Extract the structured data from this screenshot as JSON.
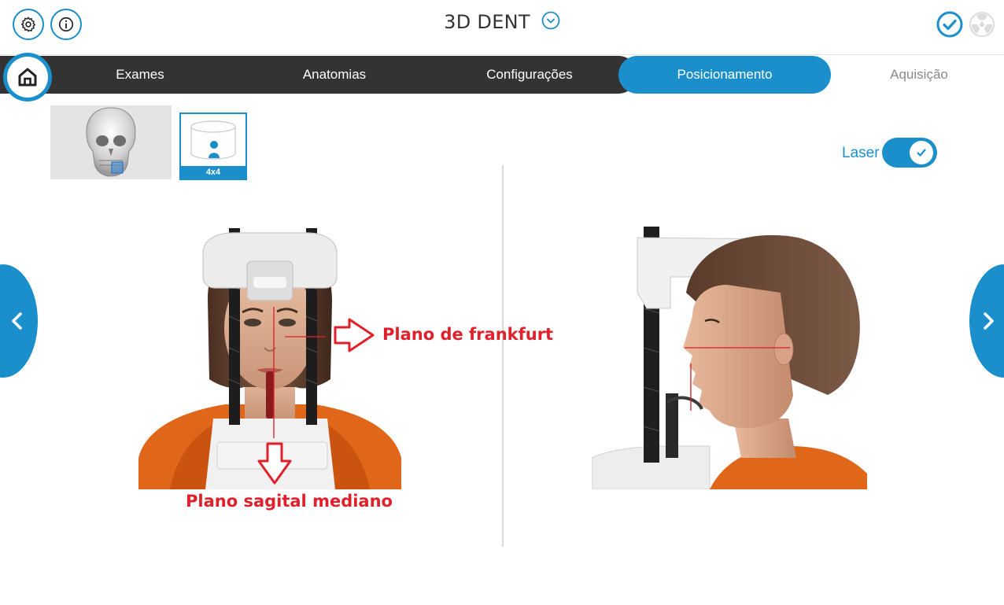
{
  "header": {
    "title": "3D DENT",
    "settings_icon": "gear-icon",
    "info_icon": "info-icon",
    "dropdown_icon": "chevron-down-icon",
    "confirm_icon": "check-circle-icon",
    "radiation_icon": "radiation-icon"
  },
  "nav": {
    "home_icon": "home-icon",
    "tabs": [
      {
        "label": "Exames"
      },
      {
        "label": "Anatomias"
      },
      {
        "label": "Configurações"
      },
      {
        "label": "Posicionamento"
      },
      {
        "label": "Aquisição"
      }
    ],
    "active_tab": "Posicionamento"
  },
  "thumbnails": {
    "fov_label": "4x4"
  },
  "laser": {
    "label": "Laser",
    "enabled": true
  },
  "annotations": {
    "frankfurt": "Plano de frankfurt",
    "sagital": "Plano sagital mediano"
  },
  "colors": {
    "accent": "#1a8fcc",
    "nav_dark": "#333333",
    "annotation": "#e0202a"
  }
}
